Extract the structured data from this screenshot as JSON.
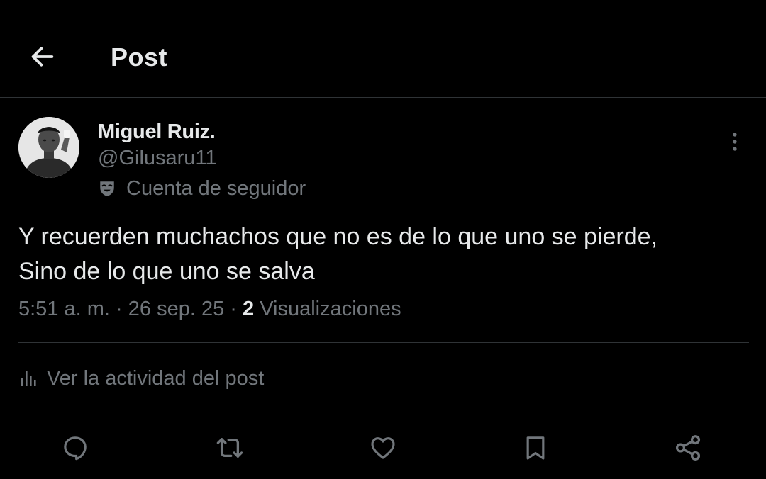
{
  "header": {
    "title": "Post",
    "back_icon": "arrow-left-icon"
  },
  "author": {
    "name": "Miguel Ruiz.",
    "handle": "@Gilusaru11",
    "badge_icon": "theater-masks-icon",
    "badge_text": "Cuenta de seguidor",
    "avatar_icon": "avatar-photo"
  },
  "post": {
    "lines": [
      "Y recuerden muchachos que no es de lo que uno se pierde,",
      "Sino de lo que uno se salva"
    ],
    "time": "5:51 a. m.",
    "separator": "·",
    "date": "26 sep. 25",
    "views_count": "2",
    "views_label": "Visualizaciones"
  },
  "activity": {
    "label": "Ver la actividad del post",
    "icon": "analytics-bars-icon"
  },
  "actions": [
    "reply-icon",
    "repost-icon",
    "like-icon",
    "bookmark-icon",
    "share-icon"
  ],
  "colors": {
    "background": "#000000",
    "text": "#e7e9ea",
    "secondary": "#71767b",
    "divider": "#2f3336"
  }
}
